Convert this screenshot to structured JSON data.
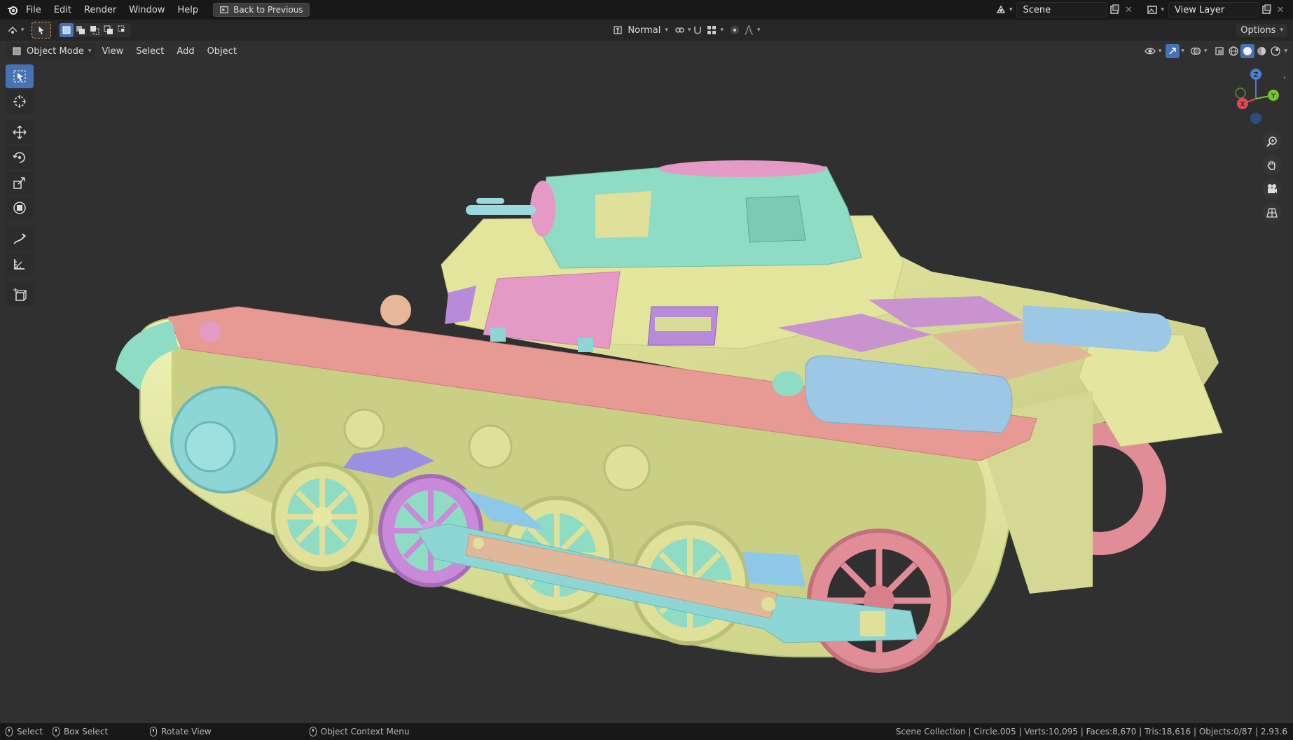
{
  "topbar": {
    "menu": [
      "File",
      "Edit",
      "Render",
      "Window",
      "Help"
    ],
    "back_label": "Back to Previous",
    "scene_value": "Scene",
    "view_layer_value": "View Layer"
  },
  "tool_header": {
    "transform_orientation": "Normal",
    "options_label": "Options"
  },
  "view_header": {
    "mode": "Object Mode",
    "menus": [
      "View",
      "Select",
      "Add",
      "Object"
    ]
  },
  "gizmo": {
    "x": "X",
    "y": "Y",
    "z": "Z"
  },
  "statusbar": {
    "select": "Select",
    "box_select": "Box Select",
    "rotate_view": "Rotate View",
    "context_menu": "Object Context Menu",
    "stats": "Scene Collection | Circle.005 | Verts:10,095 | Faces:8,670 | Tris:18,616 | Objects:0/87 | 2.93.6"
  },
  "colors": {
    "hull": "#dfe09a",
    "track": "#e8eda6",
    "fender": "#e79a94",
    "turret": "#8fdcc4",
    "pink": "#e59ac6",
    "violet": "#b78bd9",
    "blue": "#9cc8e6",
    "teal": "#8ed6d6",
    "tan": "#e0b79a",
    "accent": "#4772b3"
  }
}
